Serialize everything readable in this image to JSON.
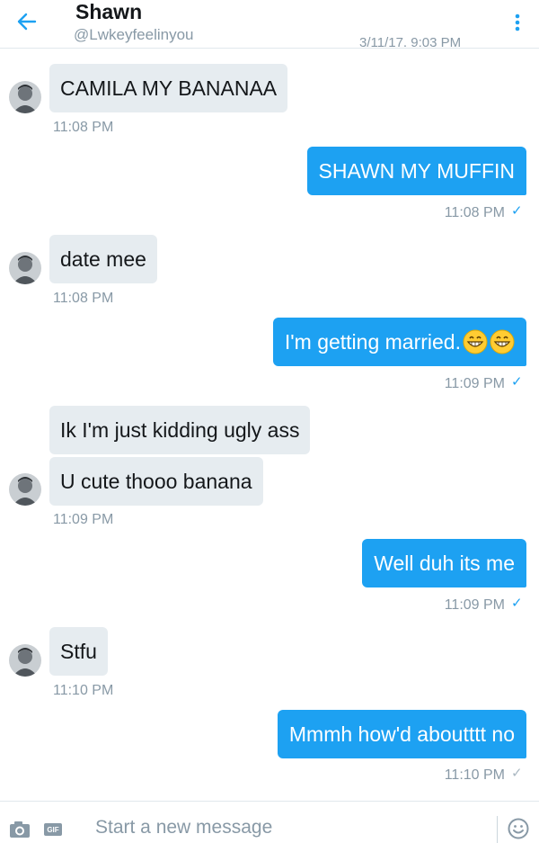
{
  "header": {
    "name": "Shawn",
    "handle": "@Lwkeyfeelinyou",
    "cut_off_timestamp": "3/11/17, 9:03 PM"
  },
  "messages": [
    {
      "direction": "in",
      "text": "CAMILA MY BANANAA",
      "time": "11:08 PM"
    },
    {
      "direction": "out",
      "text": "SHAWN MY MUFFIN",
      "time": "11:08 PM"
    },
    {
      "direction": "in",
      "text": "date mee",
      "time": "11:08 PM"
    },
    {
      "direction": "out",
      "text": "I'm getting married.",
      "emoji": [
        "grinning-face-icon",
        "grinning-face-icon"
      ],
      "time": "11:09 PM"
    },
    {
      "direction": "in",
      "text": "Ik I'm just kidding ugly ass"
    },
    {
      "direction": "in",
      "text": "U cute thooo banana",
      "time": "11:09 PM"
    },
    {
      "direction": "out",
      "text": "Well duh its me",
      "time": "11:09 PM"
    },
    {
      "direction": "in",
      "text": "Stfu",
      "time": "11:10 PM"
    },
    {
      "direction": "out",
      "text": "Mmmh how'd aboutttt no",
      "time": "11:10 PM"
    }
  ],
  "composer": {
    "placeholder": "Start a new message",
    "gif_label": "GIF"
  },
  "colors": {
    "accent": "#1da1f2",
    "incoming_bubble": "#e6ecf0",
    "muted_text": "#8899a6"
  }
}
